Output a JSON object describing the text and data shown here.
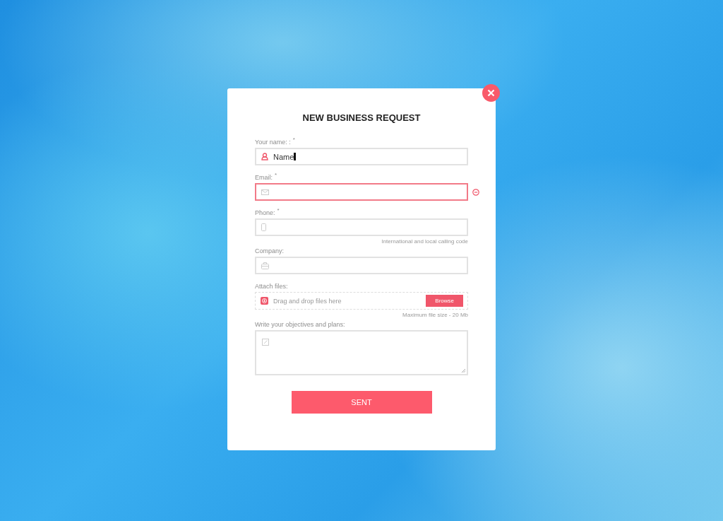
{
  "dialog": {
    "title": "NEW BUSINESS REQUEST",
    "fields": [
      {
        "kind": "person",
        "label": "Your name: :",
        "mark": "*",
        "value": "Name",
        "focused": true,
        "invalid": false
      },
      {
        "kind": "email",
        "label": "Email:",
        "mark": "*",
        "focused": false,
        "invalid": true
      },
      {
        "kind": "phone",
        "label": "Phone:",
        "mark": "*",
        "focused": false,
        "invalid": false,
        "hint": "International and local calling code"
      },
      {
        "kind": "company",
        "label": "Company:",
        "focused": false,
        "invalid": false
      },
      {
        "kind": "file",
        "label": "Attach files:",
        "placeholder": "Drag and drop files here",
        "button": "Browse",
        "hint": "Maximum file size - 20 Mb"
      },
      {
        "kind": "textarea",
        "label": "Write your objectives and plans:"
      }
    ],
    "submit": "SENT"
  }
}
